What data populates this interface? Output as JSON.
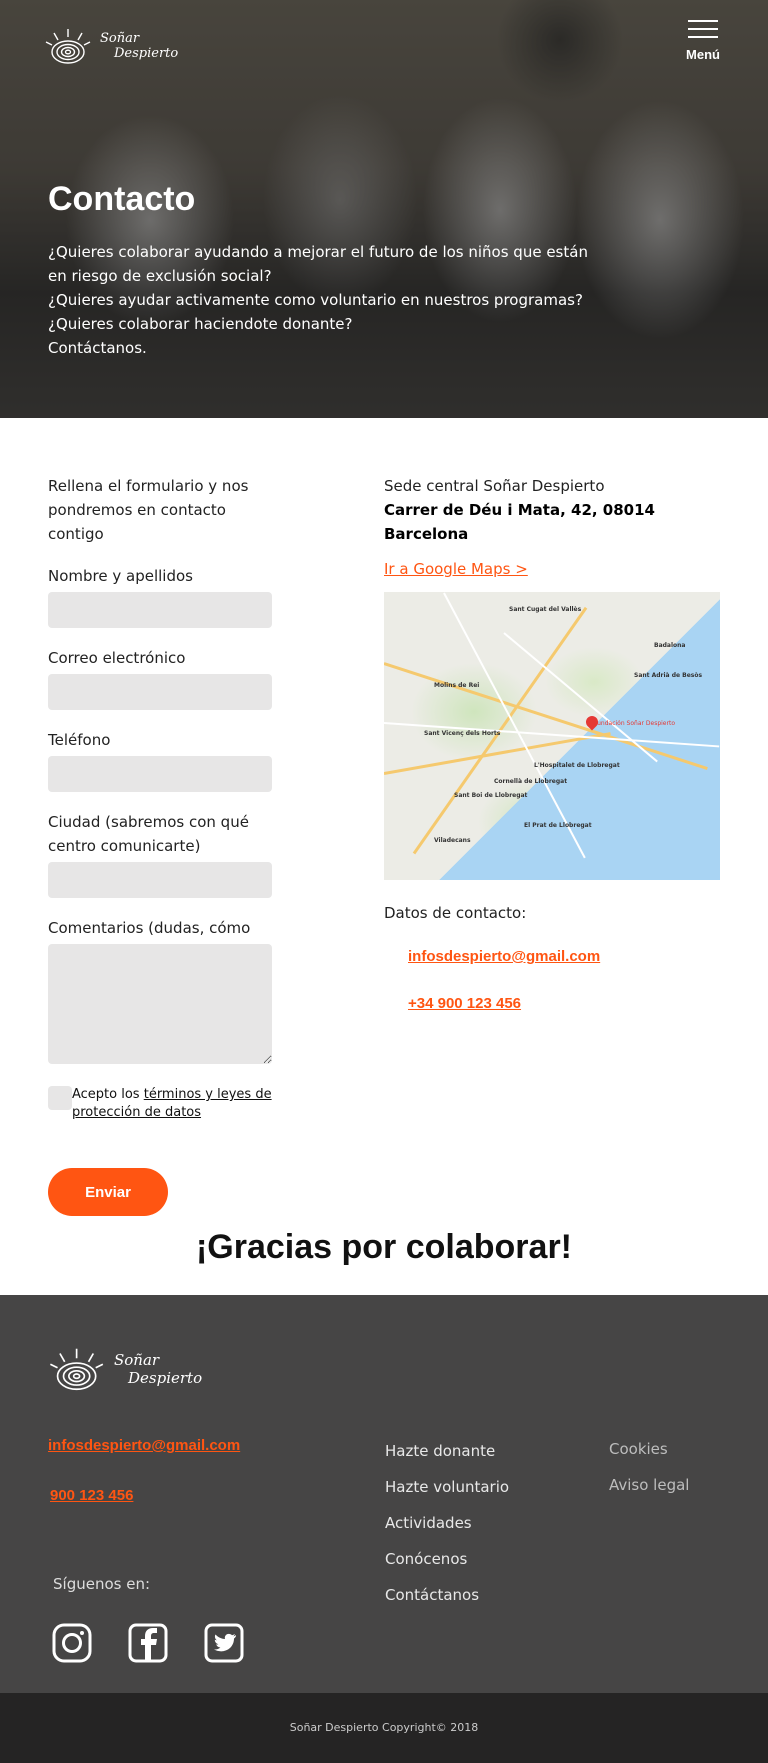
{
  "header": {
    "logo_line1": "Soñar",
    "logo_line2": "Despierto",
    "menu_label": "Menú"
  },
  "hero": {
    "title": "Contacto",
    "lines": [
      "¿Quieres colaborar ayudando a mejorar el futuro de los niños que están en riesgo de exclusión social?",
      "¿Quieres ayudar activamente como voluntario en nuestros programas?",
      "¿Quieres colaborar haciendote donante?",
      "Contáctanos."
    ]
  },
  "form": {
    "intro": "Rellena el formulario y nos pondremos en contacto contigo",
    "fields": {
      "name_label": "Nombre y apellidos",
      "email_label": "Correo electrónico",
      "phone_label": "Teléfono",
      "city_label": "Ciudad (sabremos con qué centro comunicarte)",
      "comments_label": "Comentarios (dudas, cómo"
    },
    "consent_prefix": "Acepto los ",
    "consent_link": "términos y leyes de protección de datos",
    "submit_label": "Enviar"
  },
  "sede": {
    "title": "Sede central Soñar Despierto",
    "address": "Carrer de Déu i Mata, 42, 08014 Barcelona",
    "maps_link": "Ir a Google Maps >",
    "map_pin_label": "Fundación Soñar Despierto",
    "map_cities": [
      "Sant Cugat del Vallès",
      "Badalona",
      "Sant Adrià de Besòs",
      "L'Hospitalet de Llobregat",
      "Sant Boi de Llobregat",
      "Cornellà de Llobregat",
      "El Prat de Llobregat",
      "Viladecans",
      "Molins de Rei",
      "Sant Vicenç dels Horts"
    ]
  },
  "contact": {
    "heading": "Datos de contacto:",
    "email": "infosdespierto@gmail.com",
    "phone": "+34 900 123 456"
  },
  "thanks": "¡Gracias por colaborar!",
  "footer": {
    "email": "infosdespierto@gmail.com",
    "phone": "900 123 456",
    "follow": "Síguenos en:",
    "nav": [
      "Hazte donante",
      "Hazte voluntario",
      "Actividades",
      "Conócenos",
      "Contáctanos"
    ],
    "legal": [
      "Cookies",
      "Aviso legal"
    ],
    "social_icons": [
      "instagram-icon",
      "facebook-icon",
      "twitter-icon"
    ],
    "copyright": "Soñar Despierto Copyright© 2018"
  },
  "colors": {
    "accent": "#ff5512",
    "input_bg": "#e7e6e6",
    "footer_bg": "#464545",
    "copyright_bg": "#252424"
  }
}
